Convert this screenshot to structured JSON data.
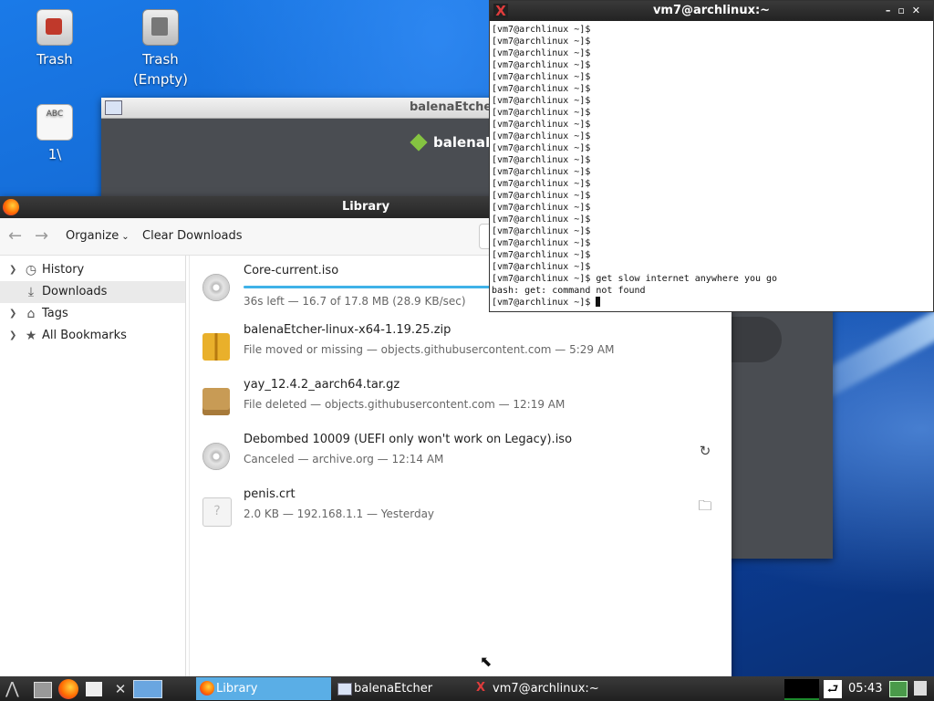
{
  "desktop": {
    "icons": [
      {
        "label": "Trash"
      },
      {
        "label": "Trash\n(Empty)"
      },
      {
        "label": "1\\"
      }
    ]
  },
  "etcher": {
    "title": "balenaEtcher",
    "brand": "balenaE"
  },
  "library": {
    "title": "Library",
    "toolbar": {
      "organize": "Organize",
      "clear": "Clear Downloads"
    },
    "sidebar": [
      {
        "label": "History"
      },
      {
        "label": "Downloads"
      },
      {
        "label": "Tags"
      },
      {
        "label": "All Bookmarks"
      }
    ],
    "downloads": [
      {
        "name": "Core-current.iso",
        "meta": "36s left — 16.7 of 17.8 MB (28.9 KB/sec)",
        "progress": 0.94
      },
      {
        "name": "balenaEtcher-linux-x64-1.19.25.zip",
        "meta": "File moved or missing — objects.githubusercontent.com — 5:29 AM"
      },
      {
        "name": "yay_12.4.2_aarch64.tar.gz",
        "meta": "File deleted — objects.githubusercontent.com — 12:19 AM"
      },
      {
        "name": "Debombed 10009 (UEFI only won't work on Legacy).iso",
        "meta": "Canceled — archive.org — 12:14 AM"
      },
      {
        "name": "penis.crt",
        "meta": "2.0 KB — 192.168.1.1 — Yesterday"
      }
    ]
  },
  "terminal": {
    "title": "vm7@archlinux:~",
    "lines": "[vm7@archlinux ~]$\n[vm7@archlinux ~]$\n[vm7@archlinux ~]$\n[vm7@archlinux ~]$\n[vm7@archlinux ~]$\n[vm7@archlinux ~]$\n[vm7@archlinux ~]$\n[vm7@archlinux ~]$\n[vm7@archlinux ~]$\n[vm7@archlinux ~]$\n[vm7@archlinux ~]$\n[vm7@archlinux ~]$\n[vm7@archlinux ~]$\n[vm7@archlinux ~]$\n[vm7@archlinux ~]$\n[vm7@archlinux ~]$\n[vm7@archlinux ~]$\n[vm7@archlinux ~]$\n[vm7@archlinux ~]$\n[vm7@archlinux ~]$\n[vm7@archlinux ~]$\n[vm7@archlinux ~]$ get slow internet anywhere you go\nbash: get: command not found\n[vm7@archlinux ~]$ "
  },
  "taskbar": {
    "tasks": [
      {
        "label": "Library"
      },
      {
        "label": "balenaEtcher"
      },
      {
        "label": "vm7@archlinux:~"
      }
    ],
    "clock": "05:43"
  }
}
